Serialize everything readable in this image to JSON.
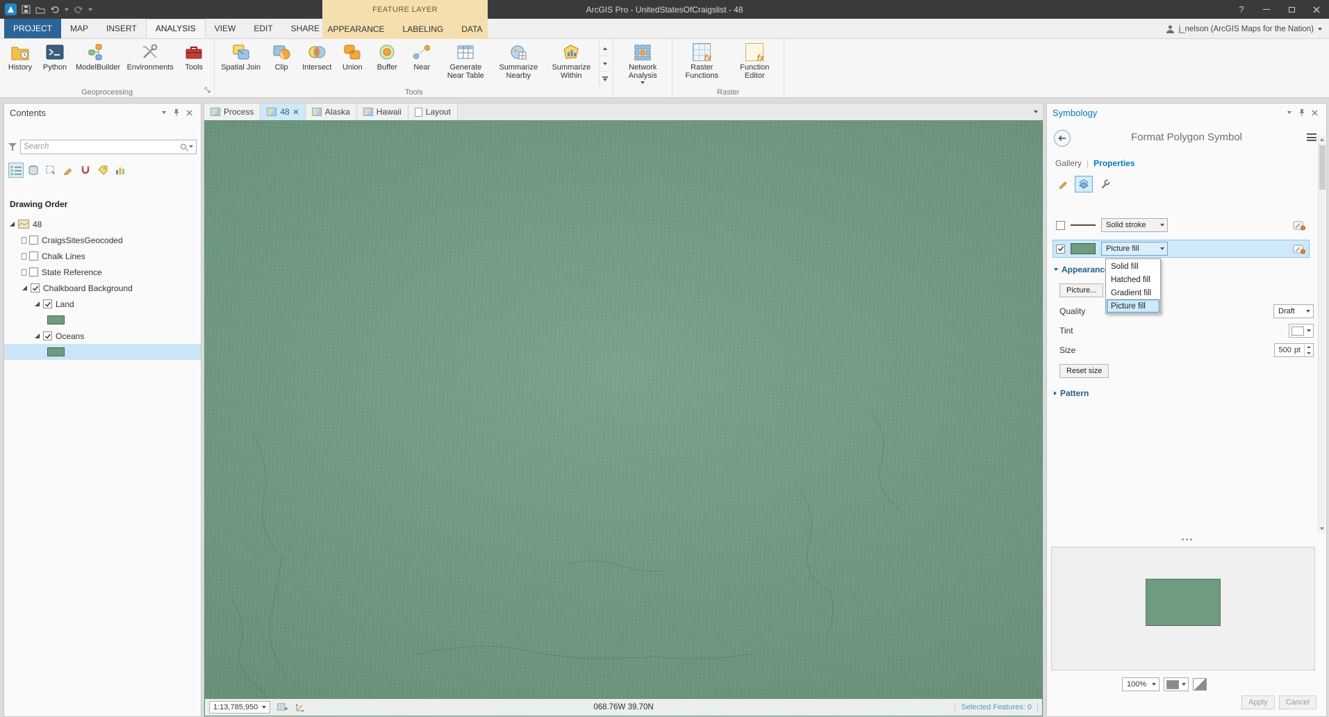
{
  "colors": {
    "accent_blue": "#0079c1",
    "chalkboard_green": "#6f9c81",
    "contextual_tan": "#f5dfae",
    "selection_highlight": "#cfe9fa",
    "project_tab_blue": "#2a6596"
  },
  "titlebar": {
    "contextual_group": "FEATURE LAYER",
    "title": "ArcGIS Pro - UnitedStatesOfCraigslist - 48",
    "help": "?"
  },
  "tabs": [
    {
      "label": "PROJECT"
    },
    {
      "label": "MAP"
    },
    {
      "label": "INSERT"
    },
    {
      "label": "ANALYSIS"
    },
    {
      "label": "VIEW"
    },
    {
      "label": "EDIT"
    },
    {
      "label": "SHARE"
    },
    {
      "label": "APPEARANCE"
    },
    {
      "label": "LABELING"
    },
    {
      "label": "DATA"
    }
  ],
  "account": {
    "user": "j_nelson (ArcGIS Maps for the Nation)"
  },
  "ribbon": {
    "geoprocessing": {
      "label": "Geoprocessing",
      "buttons": [
        {
          "label": "History"
        },
        {
          "label": "Python"
        },
        {
          "label": "ModelBuilder"
        },
        {
          "label": "Environments"
        },
        {
          "label": "Tools"
        }
      ]
    },
    "tools": {
      "label": "Tools",
      "buttons": [
        {
          "label": "Spatial Join"
        },
        {
          "label": "Clip"
        },
        {
          "label": "Intersect"
        },
        {
          "label": "Union"
        },
        {
          "label": "Buffer"
        },
        {
          "label": "Near"
        },
        {
          "label": "Generate Near Table"
        },
        {
          "label": "Summarize Nearby"
        },
        {
          "label": "Summarize Within"
        }
      ]
    },
    "network": {
      "label": "Network Analysis"
    },
    "raster": {
      "label": "Raster",
      "icon_text": "fx",
      "buttons": [
        {
          "label": "Raster Functions"
        },
        {
          "label": "Function Editor"
        }
      ]
    }
  },
  "doc_tabs": [
    {
      "label": "Process"
    },
    {
      "label": "48"
    },
    {
      "label": "Alaska"
    },
    {
      "label": "Hawaii"
    },
    {
      "label": "Layout"
    }
  ],
  "contents": {
    "title": "Contents",
    "search_placeholder": "Search",
    "section": "Drawing Order",
    "map_name": "48",
    "layers": [
      {
        "label": "CraigsSitesGeocoded"
      },
      {
        "label": "Chalk Lines"
      },
      {
        "label": "State Reference"
      },
      {
        "label": "Chalkboard Background"
      }
    ],
    "sublayers": [
      {
        "label": "Land"
      },
      {
        "label": "Oceans"
      }
    ]
  },
  "statusbar": {
    "scale": "1:13,785,950",
    "coordinates": "068.76W 39.70N",
    "selection": "Selected Features: 0"
  },
  "symbology": {
    "title": "Symbology",
    "header": "Format Polygon Symbol",
    "gallery_tab": "Gallery",
    "properties_tab": "Properties",
    "tab_separator": "|",
    "stroke_type": "Solid stroke",
    "fill_type": "Picture fill",
    "fill_menu": [
      {
        "label": "Solid fill"
      },
      {
        "label": "Hatched fill"
      },
      {
        "label": "Gradient fill"
      },
      {
        "label": "Picture fill"
      }
    ],
    "appearance_section": "Appearance",
    "picture_button": "Picture...",
    "quality_label": "Quality",
    "quality_value": "Draft",
    "tint_label": "Tint",
    "size_label": "Size",
    "size_value": "500",
    "size_unit": "pt",
    "reset_button": "Reset size",
    "pattern_section": "Pattern",
    "zoom_value": "100%",
    "apply_button": "Apply",
    "cancel_button": "Cancel"
  }
}
